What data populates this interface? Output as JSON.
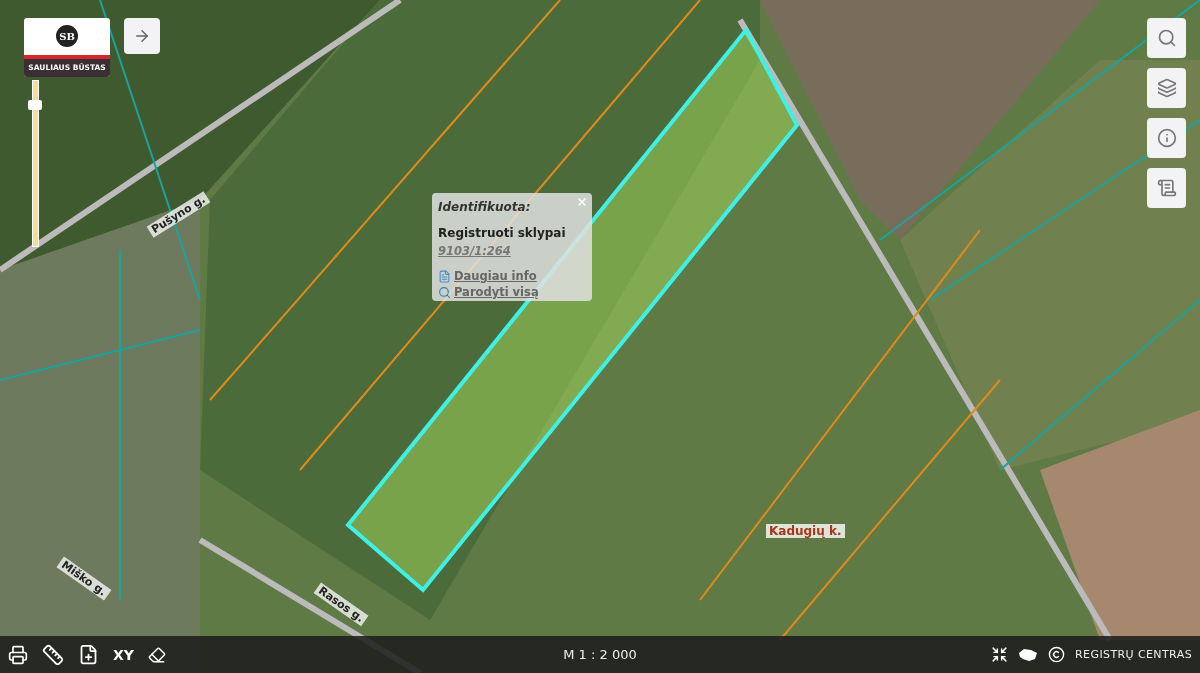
{
  "logo": {
    "monogram": "SB",
    "name": "SAULIAUS BŪSTAS"
  },
  "zoom": {
    "level": 0.88
  },
  "map_labels": [
    {
      "kind": "street",
      "text": "Pušyno g."
    },
    {
      "kind": "street",
      "text": "Miško g."
    },
    {
      "kind": "street",
      "text": "Rasos g."
    },
    {
      "kind": "village",
      "text": "Kadugių k."
    }
  ],
  "popup": {
    "title": "Identifikuota:",
    "layer": "Registruoti sklypai",
    "parcel": "9103/1:264",
    "links": [
      {
        "kind": "info",
        "label": "Daugiau info"
      },
      {
        "kind": "zoom",
        "label": "Parodyti visą"
      }
    ]
  },
  "right_tools": [
    {
      "kind": "search"
    },
    {
      "kind": "layers"
    },
    {
      "kind": "info"
    },
    {
      "kind": "legend"
    }
  ],
  "bottom_bar": {
    "tools": [
      {
        "kind": "print"
      },
      {
        "kind": "measure"
      },
      {
        "kind": "add-page"
      },
      {
        "kind": "xy",
        "label": "XY"
      },
      {
        "kind": "eraser"
      }
    ],
    "scale": "M 1 : 2 000",
    "right": [
      {
        "kind": "fullscreen"
      },
      {
        "kind": "country"
      }
    ],
    "credit": "REGISTRŲ CENTRAS"
  }
}
